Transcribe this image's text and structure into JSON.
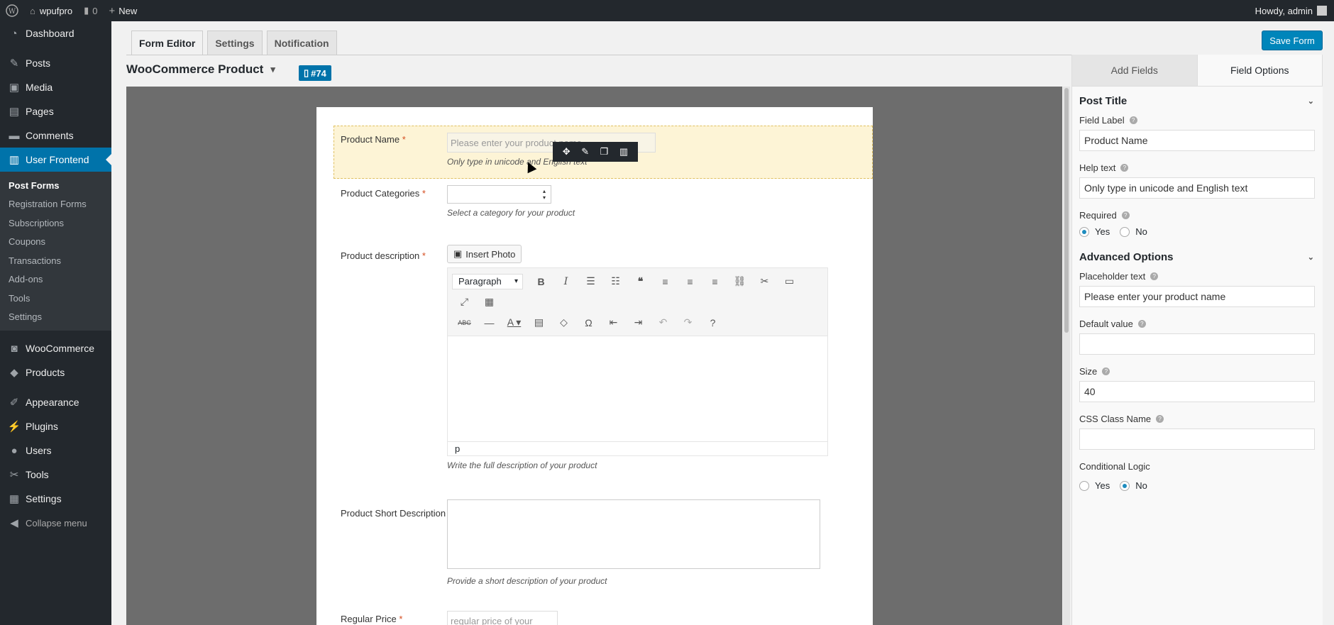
{
  "adminbar": {
    "site_name": "wpufpro",
    "comments_count": "0",
    "new_label": "New",
    "howdy": "Howdy, admin"
  },
  "sidebar": {
    "items_top": [
      {
        "label": "Dashboard",
        "icon": "dashboard-icon",
        "glyph": "◔"
      }
    ],
    "items_mid": [
      {
        "label": "Posts",
        "icon": "pin-icon",
        "glyph": "✎"
      },
      {
        "label": "Media",
        "icon": "media-icon",
        "glyph": "▣"
      },
      {
        "label": "Pages",
        "icon": "pages-icon",
        "glyph": "▤"
      },
      {
        "label": "Comments",
        "icon": "comments-icon",
        "glyph": "▬"
      }
    ],
    "active_label": "User Frontend",
    "submenu": [
      "Post Forms",
      "Registration Forms",
      "Subscriptions",
      "Coupons",
      "Transactions",
      "Add-ons",
      "Tools",
      "Settings"
    ],
    "items_bottom": [
      {
        "label": "WooCommerce",
        "icon": "woocommerce-icon",
        "glyph": "◙"
      },
      {
        "label": "Products",
        "icon": "products-icon",
        "glyph": "◆"
      }
    ],
    "items_tail": [
      {
        "label": "Appearance",
        "icon": "appearance-icon",
        "glyph": "✐"
      },
      {
        "label": "Plugins",
        "icon": "plugins-icon",
        "glyph": "⚡"
      },
      {
        "label": "Users",
        "icon": "users-icon",
        "glyph": "●"
      },
      {
        "label": "Tools",
        "icon": "tools-icon",
        "glyph": "✂"
      },
      {
        "label": "Settings",
        "icon": "settings-icon",
        "glyph": "▦"
      },
      {
        "label": "Collapse menu",
        "icon": "collapse-icon",
        "glyph": "◀"
      }
    ]
  },
  "tabs": [
    "Form Editor",
    "Settings",
    "Notification"
  ],
  "save_label": "Save Form",
  "form": {
    "title": "WooCommerce Product",
    "badge": "#74"
  },
  "fields": {
    "product_name": {
      "label": "Product Name",
      "required": "*",
      "placeholder": "Please enter your product name",
      "help": "Only type in unicode and English text"
    },
    "categories": {
      "label": "Product Categories",
      "required": "*",
      "help": "Select a category for your product"
    },
    "description": {
      "label": "Product description",
      "required": "*",
      "insert_photo": "Insert Photo",
      "paragraph": "Paragraph",
      "status_tag": "p",
      "help": "Write the full description of your product"
    },
    "short_description": {
      "label": "Product Short Description",
      "help": "Provide a short description of your product"
    },
    "regular_price": {
      "label": "Regular Price",
      "required": "*",
      "placeholder": "regular price of your"
    }
  },
  "panel": {
    "tabs": [
      "Add Fields",
      "Field Options"
    ],
    "post_title": "Post Title",
    "field_label": "Field Label",
    "field_label_value": "Product Name",
    "help_text": "Help text",
    "help_text_value": "Only type in unicode and English text",
    "required": "Required",
    "yes": "Yes",
    "no": "No",
    "advanced": "Advanced Options",
    "placeholder_text": "Placeholder text",
    "placeholder_value": "Please enter your product name",
    "default_value": "Default value",
    "size": "Size",
    "size_value": "40",
    "css_class": "CSS Class Name",
    "conditional": "Conditional Logic"
  },
  "colors": {
    "accent": "#0073aa",
    "button": "#0085ba",
    "selected_row": "#fdf4d6"
  }
}
